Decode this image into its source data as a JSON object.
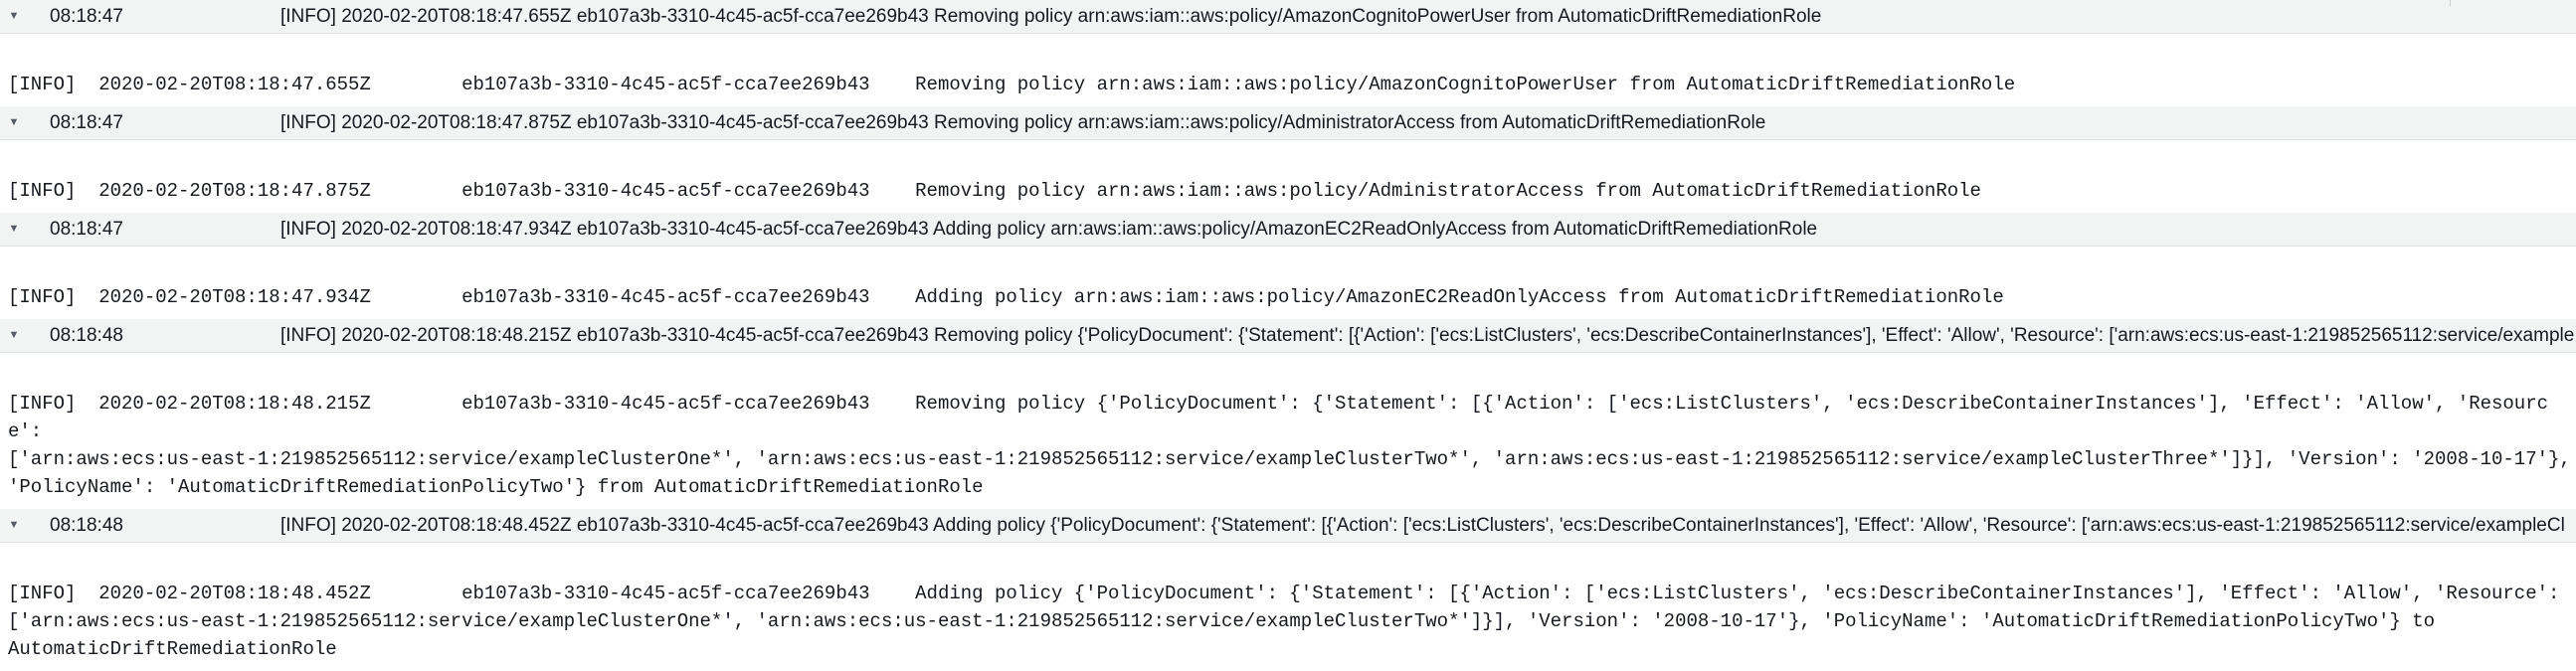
{
  "entries": [
    {
      "time": "08:18:47",
      "summary": "[INFO] 2020-02-20T08:18:47.655Z eb107a3b-3310-4c45-ac5f-cca7ee269b43 Removing policy arn:aws:iam::aws:policy/AmazonCognitoPowerUser from AutomaticDriftRemediationRole",
      "detail": "[INFO]  2020-02-20T08:18:47.655Z        eb107a3b-3310-4c45-ac5f-cca7ee269b43    Removing policy arn:aws:iam::aws:policy/AmazonCognitoPowerUser from AutomaticDriftRemediationRole"
    },
    {
      "time": "08:18:47",
      "summary": "[INFO] 2020-02-20T08:18:47.875Z eb107a3b-3310-4c45-ac5f-cca7ee269b43 Removing policy arn:aws:iam::aws:policy/AdministratorAccess from AutomaticDriftRemediationRole",
      "detail": "[INFO]  2020-02-20T08:18:47.875Z        eb107a3b-3310-4c45-ac5f-cca7ee269b43    Removing policy arn:aws:iam::aws:policy/AdministratorAccess from AutomaticDriftRemediationRole"
    },
    {
      "time": "08:18:47",
      "summary": "[INFO] 2020-02-20T08:18:47.934Z eb107a3b-3310-4c45-ac5f-cca7ee269b43 Adding policy arn:aws:iam::aws:policy/AmazonEC2ReadOnlyAccess from AutomaticDriftRemediationRole",
      "detail": "[INFO]  2020-02-20T08:18:47.934Z        eb107a3b-3310-4c45-ac5f-cca7ee269b43    Adding policy arn:aws:iam::aws:policy/AmazonEC2ReadOnlyAccess from AutomaticDriftRemediationRole"
    },
    {
      "time": "08:18:48",
      "summary": "[INFO] 2020-02-20T08:18:48.215Z eb107a3b-3310-4c45-ac5f-cca7ee269b43 Removing policy {'PolicyDocument': {'Statement': [{'Action': ['ecs:ListClusters', 'ecs:DescribeContainerInstances'], 'Effect': 'Allow', 'Resource': ['arn:aws:ecs:us-east-1:219852565112:service/example",
      "detail": "[INFO]  2020-02-20T08:18:48.215Z        eb107a3b-3310-4c45-ac5f-cca7ee269b43    Removing policy {'PolicyDocument': {'Statement': [{'Action': ['ecs:ListClusters', 'ecs:DescribeContainerInstances'], 'Effect': 'Allow', 'Resource':\n['arn:aws:ecs:us-east-1:219852565112:service/exampleClusterOne*', 'arn:aws:ecs:us-east-1:219852565112:service/exampleClusterTwo*', 'arn:aws:ecs:us-east-1:219852565112:service/exampleClusterThree*']}], 'Version': '2008-10-17'},\n'PolicyName': 'AutomaticDriftRemediationPolicyTwo'} from AutomaticDriftRemediationRole"
    },
    {
      "time": "08:18:48",
      "summary": "[INFO] 2020-02-20T08:18:48.452Z eb107a3b-3310-4c45-ac5f-cca7ee269b43 Adding policy {'PolicyDocument': {'Statement': [{'Action': ['ecs:ListClusters', 'ecs:DescribeContainerInstances'], 'Effect': 'Allow', 'Resource': ['arn:aws:ecs:us-east-1:219852565112:service/exampleCl",
      "detail": "[INFO]  2020-02-20T08:18:48.452Z        eb107a3b-3310-4c45-ac5f-cca7ee269b43    Adding policy {'PolicyDocument': {'Statement': [{'Action': ['ecs:ListClusters', 'ecs:DescribeContainerInstances'], 'Effect': 'Allow', 'Resource':\n['arn:aws:ecs:us-east-1:219852565112:service/exampleClusterOne*', 'arn:aws:ecs:us-east-1:219852565112:service/exampleClusterTwo*']}], 'Version': '2008-10-17'}, 'PolicyName': 'AutomaticDriftRemediationPolicyTwo'} to\nAutomaticDriftRemediationRole"
    }
  ],
  "icons": {
    "toggle": "caret-down-icon"
  }
}
